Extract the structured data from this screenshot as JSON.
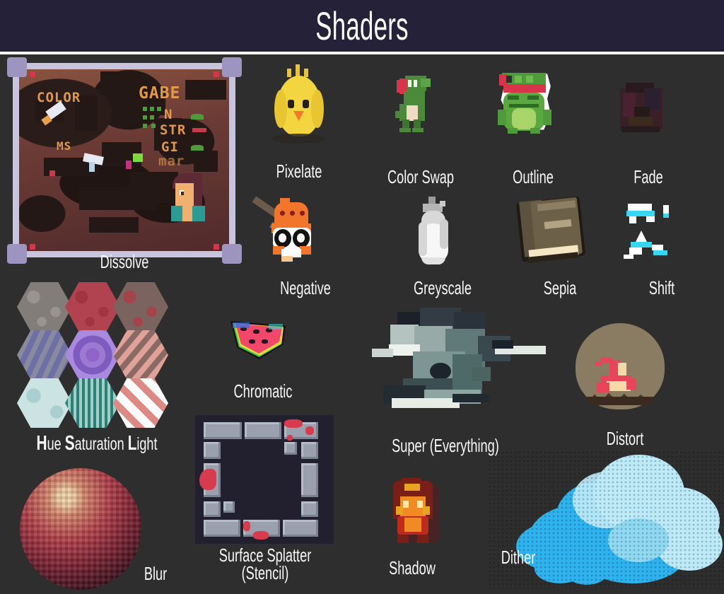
{
  "header": {
    "title": "Shaders"
  },
  "gallery": {
    "items": [
      {
        "id": "dissolve",
        "label": "Dissolve",
        "icon": "dissolve-panel-thumbnail"
      },
      {
        "id": "pixelate",
        "label": "Pixelate",
        "icon": "chick-sprite-thumbnail"
      },
      {
        "id": "colorswap",
        "label": "Color Swap",
        "icon": "dino-sprite-thumbnail"
      },
      {
        "id": "outline",
        "label": "Outline",
        "icon": "frog-sprite-thumbnail"
      },
      {
        "id": "fade",
        "label": "Fade",
        "icon": "faded-sprite-thumbnail"
      },
      {
        "id": "negative",
        "label": "Negative",
        "icon": "inverted-cat-sprite-thumbnail"
      },
      {
        "id": "greyscale",
        "label": "Greyscale",
        "icon": "grey-blob-sprite-thumbnail"
      },
      {
        "id": "sepia",
        "label": "Sepia",
        "icon": "book-sprite-thumbnail"
      },
      {
        "id": "shift",
        "label": "Shift",
        "icon": "shifted-sprite-thumbnail"
      },
      {
        "id": "hsl",
        "label": "Hue Saturation Light",
        "label_parts": [
          "H",
          "ue ",
          "S",
          "aturation ",
          "L",
          "ight"
        ],
        "icon": "hexagon-grid-thumbnail"
      },
      {
        "id": "chromatic",
        "label": "Chromatic",
        "icon": "watermelon-sprite-thumbnail"
      },
      {
        "id": "super",
        "label": "Super (Everything)",
        "icon": "ghost-creature-thumbnail"
      },
      {
        "id": "distort",
        "label": "Distort",
        "icon": "campfire-heathaze-thumbnail"
      },
      {
        "id": "blur",
        "label": "Blur",
        "icon": "blurred-sphere-thumbnail"
      },
      {
        "id": "splatter",
        "label": "Surface Splatter\n(Stencil)",
        "icon": "stone-frame-splatter-thumbnail"
      },
      {
        "id": "shadow",
        "label": "Shadow",
        "icon": "character-shadow-sprite-thumbnail"
      },
      {
        "id": "dither",
        "label": "Dither",
        "icon": "dithered-cloud-thumbnail"
      }
    ]
  },
  "dissolve_art": {
    "texts": [
      "COLOR",
      "GABE",
      "N",
      "STR",
      "GI",
      "mar",
      "MS"
    ]
  },
  "colors": {
    "header_bg": "#242139",
    "body_bg": "#2e2e2e",
    "divider": "#f4f4f4",
    "label_text": "#f7f7f7",
    "accent_red": "#d93b4e",
    "dither_blue": "#2eb3ef",
    "dither_light": "#bdeaf8"
  }
}
